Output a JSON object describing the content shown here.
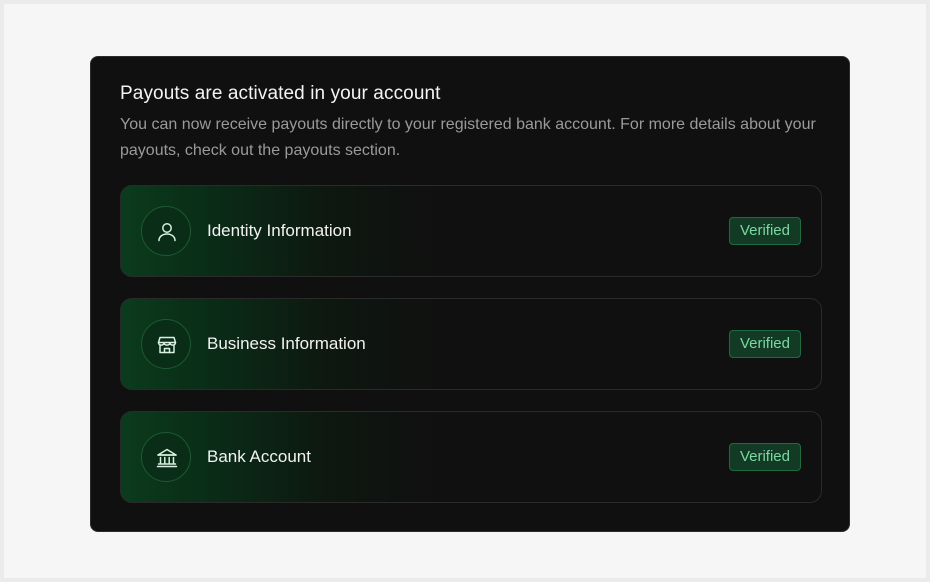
{
  "card": {
    "title": "Payouts are activated in your account",
    "description": "You can now receive payouts directly to your registered bank account. For more details about your payouts, check out the payouts section."
  },
  "items": [
    {
      "icon": "user-icon",
      "label": "Identity Information",
      "status": "Verified"
    },
    {
      "icon": "store-icon",
      "label": "Business Information",
      "status": "Verified"
    },
    {
      "icon": "bank-icon",
      "label": "Bank Account",
      "status": "Verified"
    }
  ],
  "colors": {
    "card_background": "#101010",
    "accent_green": "#79d9a0",
    "badge_background": "#123a24",
    "icon_circle": "#0a2d17"
  }
}
